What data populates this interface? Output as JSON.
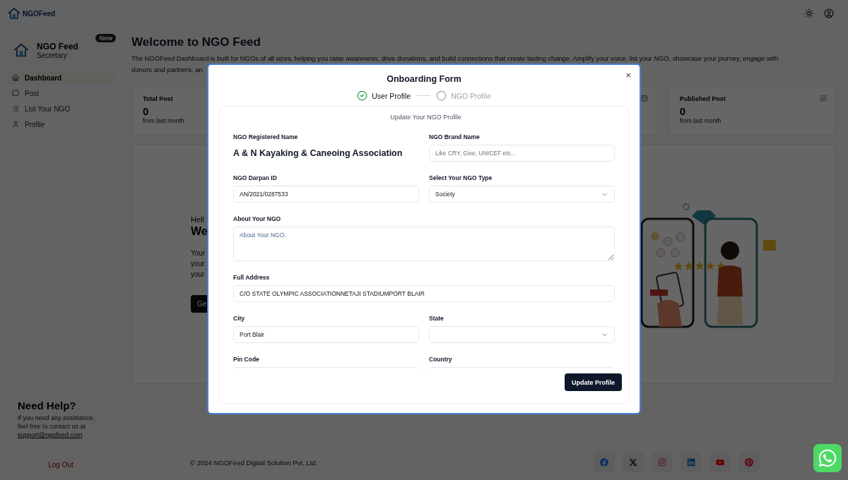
{
  "logo": {
    "text": "NGOFeed"
  },
  "profile_card": {
    "name": "NGO Feed",
    "role": "Secretary",
    "badge": "New"
  },
  "nav": [
    {
      "label": "Dashboard",
      "selected": true
    },
    {
      "label": "Post",
      "selected": false
    },
    {
      "label": "List Your NGO",
      "selected": false
    },
    {
      "label": "Profile",
      "selected": false
    }
  ],
  "help": {
    "title": "Need Help?",
    "text": "If you need any assistance, feel free to contact us at",
    "link": "support@ngofeed.com"
  },
  "logout": "Log Out",
  "welcome": {
    "title": "Welcome to NGO Feed",
    "line_1": "The NGOFeed Dashboard is built for NGOs of all sizes, helping you raise awareness, drive donations, and build connections that create lasting change. Amplify your voice, list your NGO, showcase your journey, engage with",
    "line_2": "donors and partners, an"
  },
  "stats": [
    {
      "title": "Total Post",
      "value": "0",
      "note": "from last month"
    },
    {
      "title": "Published Post",
      "value": "0",
      "note": "from last month"
    }
  ],
  "hero": {
    "greeting": "Hell",
    "heading": "We",
    "lines": [
      "Your",
      "your",
      "your"
    ],
    "button": "Ge"
  },
  "footer": {
    "copyright": "© 2024 NGOFeed Digital Solution Pvt. Ltd."
  },
  "modal": {
    "title": "Onboarding Form",
    "close": "×",
    "steps": [
      {
        "label": "User Profile",
        "done": true
      },
      {
        "label": "NGO Profile",
        "done": false
      }
    ],
    "section_title": "Update Your NGO Profile",
    "fields": [
      {
        "kind": "static",
        "label": "NGO Registered Name",
        "value": "A & N Kayaking & Caneoing Association",
        "wide": false
      },
      {
        "kind": "text",
        "label": "NGO Brand Name",
        "placeholder": "Like CRY, Give, UNICEF etc...",
        "wide": false
      },
      {
        "kind": "text",
        "label": "NGO Darpan ID",
        "value": "AN/2021/0287533",
        "wide": false
      },
      {
        "kind": "select",
        "label": "Select Your NGO Type",
        "value": "Society",
        "wide": false
      },
      {
        "kind": "textarea",
        "label": "About Your NGO",
        "placeholder": "About Your NGO.",
        "wide": true
      },
      {
        "kind": "text",
        "label": "Full Address",
        "value": "C/O STATE OLYMPIC ASSOCIATIONNETAJI STADIUMPORT BLAIR",
        "wide": true
      },
      {
        "kind": "text",
        "label": "City",
        "value": "Port Blair",
        "wide": false
      },
      {
        "kind": "select",
        "label": "State",
        "wide": false
      },
      {
        "kind": "text",
        "label": "Pin Code",
        "wide": false
      },
      {
        "kind": "text",
        "label": "Country",
        "wide": false
      }
    ],
    "submit": "Update Profile"
  }
}
